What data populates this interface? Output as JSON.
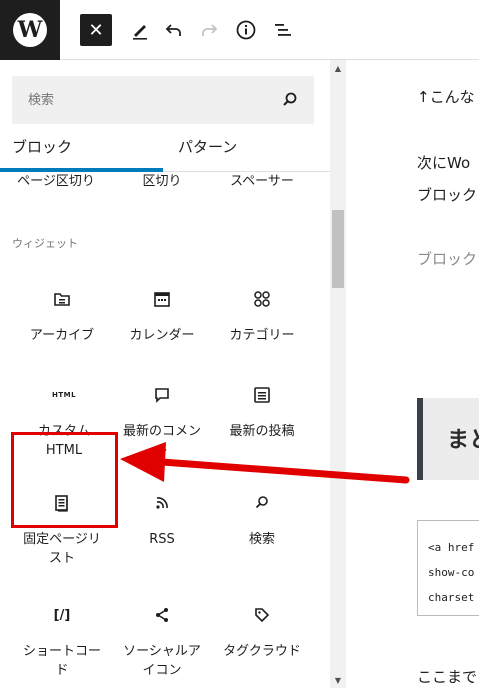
{
  "toolbar": {
    "logo": "W",
    "close_icon": "✕",
    "edit_icon": "pencil-icon",
    "undo_icon": "undo-icon",
    "redo_icon": "redo-icon",
    "info_icon": "info-icon",
    "list_view_icon": "list-view-icon"
  },
  "inserter": {
    "search_placeholder": "検索",
    "tabs": [
      {
        "label": "ブロック",
        "active": true
      },
      {
        "label": "パターン",
        "active": false
      }
    ],
    "cut_row": [
      "ページ区切り",
      "区切り",
      "スペーサー"
    ],
    "section_title": "ウィジェット",
    "blocks": [
      {
        "label": "アーカイブ",
        "icon": "archive-icon"
      },
      {
        "label": "カレンダー",
        "icon": "calendar-icon"
      },
      {
        "label": "カテゴリー",
        "icon": "categories-icon"
      },
      {
        "label_line1": "カスタム",
        "label_line2": "HTML",
        "icon_text": "HTML",
        "icon": "html-icon"
      },
      {
        "label_line1": "最新のコメン",
        "label_line2": "ト",
        "icon": "comment-icon"
      },
      {
        "label": "最新の投稿",
        "icon": "post-list-icon"
      },
      {
        "label_line1": "固定ページリ",
        "label_line2": "スト",
        "icon": "page-list-icon"
      },
      {
        "label": "RSS",
        "icon": "rss-icon"
      },
      {
        "label": "検索",
        "icon": "search-icon"
      },
      {
        "label_line1": "ショートコー",
        "label_line2": "ド",
        "icon_text": "[/]",
        "icon": "shortcode-icon"
      },
      {
        "label_line1": "ソーシャルア",
        "label_line2": "イコン",
        "icon": "share-icon"
      },
      {
        "label": "タグクラウド",
        "icon": "tag-icon"
      }
    ]
  },
  "editor": {
    "line1": "↑こんな",
    "line2": "次にWo",
    "line3": "ブロック",
    "line4": "ブロック",
    "heading": "まと",
    "code_lines": [
      "<a href",
      "show-co",
      "charset"
    ],
    "line5": "ここまで"
  },
  "colors": {
    "accent": "#007cba",
    "annotation": "#e10000",
    "dark": "#1e1e1e"
  }
}
